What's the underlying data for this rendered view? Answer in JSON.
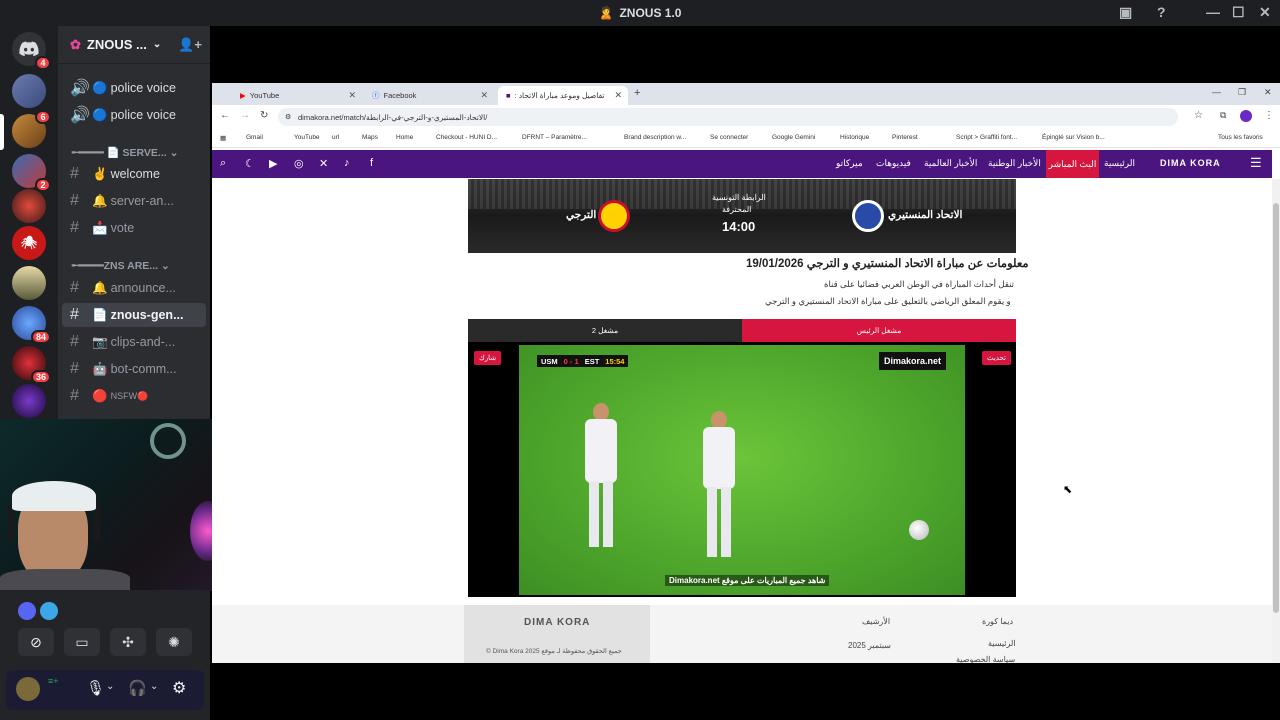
{
  "window": {
    "title": "ZNOUS 1.0"
  },
  "servers": [
    {
      "name": "discord-home",
      "badge": "4"
    },
    {
      "name": "server-2",
      "badge": ""
    },
    {
      "name": "server-3",
      "badge": "6"
    },
    {
      "name": "server-4",
      "badge": ""
    },
    {
      "name": "server-5",
      "badge": "2"
    },
    {
      "name": "server-6",
      "badge": ""
    },
    {
      "name": "server-7",
      "badge": ""
    },
    {
      "name": "server-8",
      "badge": ""
    },
    {
      "name": "server-9",
      "badge": "84"
    },
    {
      "name": "server-10",
      "badge": "36"
    },
    {
      "name": "server-11",
      "badge": ""
    }
  ],
  "sidebar": {
    "server_name": "ZNOUS ...",
    "channels": [
      {
        "icon": "🔵",
        "label": "police voice",
        "type": "voice"
      },
      {
        "icon": "🔵",
        "label": "police voice",
        "type": "voice"
      },
      {
        "label": "╾━━━━ 📄 SERVE...",
        "type": "category"
      },
      {
        "icon": "✌️",
        "label": "welcome",
        "type": "text"
      },
      {
        "icon": "🔔",
        "label": "server-an...",
        "type": "text"
      },
      {
        "icon": "📩",
        "label": "vote",
        "type": "text"
      },
      {
        "label": "╾━━━━ZNS ARE...",
        "type": "category"
      },
      {
        "icon": "🔔",
        "label": "announce...",
        "type": "text"
      },
      {
        "icon": "📄",
        "label": "znous-gen...",
        "type": "text",
        "selected": true
      },
      {
        "icon": "📷",
        "label": "clips-and-...",
        "type": "text"
      },
      {
        "icon": "🤖",
        "label": "bot-comm...",
        "type": "text"
      },
      {
        "icon": "🔴",
        "label": "NSFW🔴",
        "type": "text"
      }
    ]
  },
  "browser": {
    "tabs": [
      {
        "label": "YouTube",
        "icon": "youtube"
      },
      {
        "label": "Facebook",
        "icon": "facebook"
      },
      {
        "label": "تفاصيل وموعد مباراة الاتحاد :",
        "icon": "dimakora",
        "active": true
      }
    ],
    "url": "dimakora.net/match/الاتحاد-المستيري-و-الترجي-في-الرابطة/",
    "bookmarks": [
      "Gmail",
      "YouTube",
      "url",
      "Maps",
      "Home",
      "Checkout - HUNI D...",
      "DFRNT – Paramètre...",
      "Brand description w...",
      "Se connecter",
      "Google Gemini",
      "Historique",
      "Pinterest",
      "Script > Graffiti font...",
      "Épinglé sur Vision b...",
      "Tous les favoris"
    ]
  },
  "site": {
    "logo": "DIMA KORA",
    "nav": [
      "الرئيسية",
      "البث المباشر",
      "الأخبار الوطنية",
      "الأخبار العالمية",
      "فيديوهات",
      "ميركاتو"
    ],
    "banner": {
      "team_home": "الاتحاد المنستيري",
      "team_away": "الترجي",
      "league": "الرابطة التونسية",
      "league_sub": "المحترفة",
      "time": "14:00"
    },
    "heading": "معلومات عن مباراة الاتحاد المنستيري و الترجي 19/01/2026",
    "paragraphs": [
      "تنقل أحداث المباراة في الوطن العربي فضائيا على قناة",
      "و يقوم المعلق الرياضي بالتعليق على مباراة الاتحاد المنستيري و الترجي"
    ],
    "player": {
      "server1": "مشغل الرئيس",
      "server2": "مشغل 2",
      "share_btn": "شارك",
      "refresh_btn": "تحديث",
      "scorebug": {
        "home": "USM",
        "score": "0 - 1",
        "away": "EST",
        "clock": "15:54"
      },
      "watermark": "Dimakora.net",
      "caption": "شاهد جميع المباريات على موقع Dimakora.net"
    },
    "footer": {
      "col1_title": "ديما كورة",
      "col1_items": [
        "الرئيسية",
        "سياسة الخصوصية"
      ],
      "col2_title": "الأرشيف",
      "col2_items": [
        "سبتمبر 2025"
      ],
      "copyright": "جميع الحقوق محفوظة لـ موقع Dima Kora 2025 ©"
    }
  },
  "colors": {
    "site_nav": "#4b1580",
    "site_accent": "#d6163f",
    "discord_bg": "#2b2d31"
  }
}
